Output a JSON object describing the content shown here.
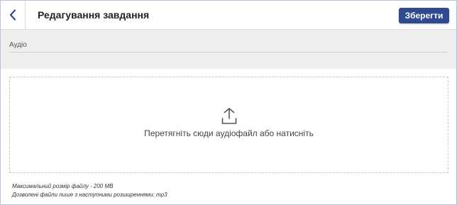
{
  "header": {
    "title": "Редагування завдання",
    "save_label": "Зберегти",
    "back_icon": "chevron-left-icon"
  },
  "field": {
    "label": "Аудіо"
  },
  "dropzone": {
    "icon": "upload-icon",
    "text": "Перетягніть сюди аудіофайл або натисніть"
  },
  "notes": {
    "max_size": "Максимальний розмір файлу - 200 MB",
    "allowed": "Дозволені файли лише з наступними розширеннями: mp3"
  },
  "colors": {
    "accent": "#2f4a8e",
    "section_bg": "#efefef"
  }
}
